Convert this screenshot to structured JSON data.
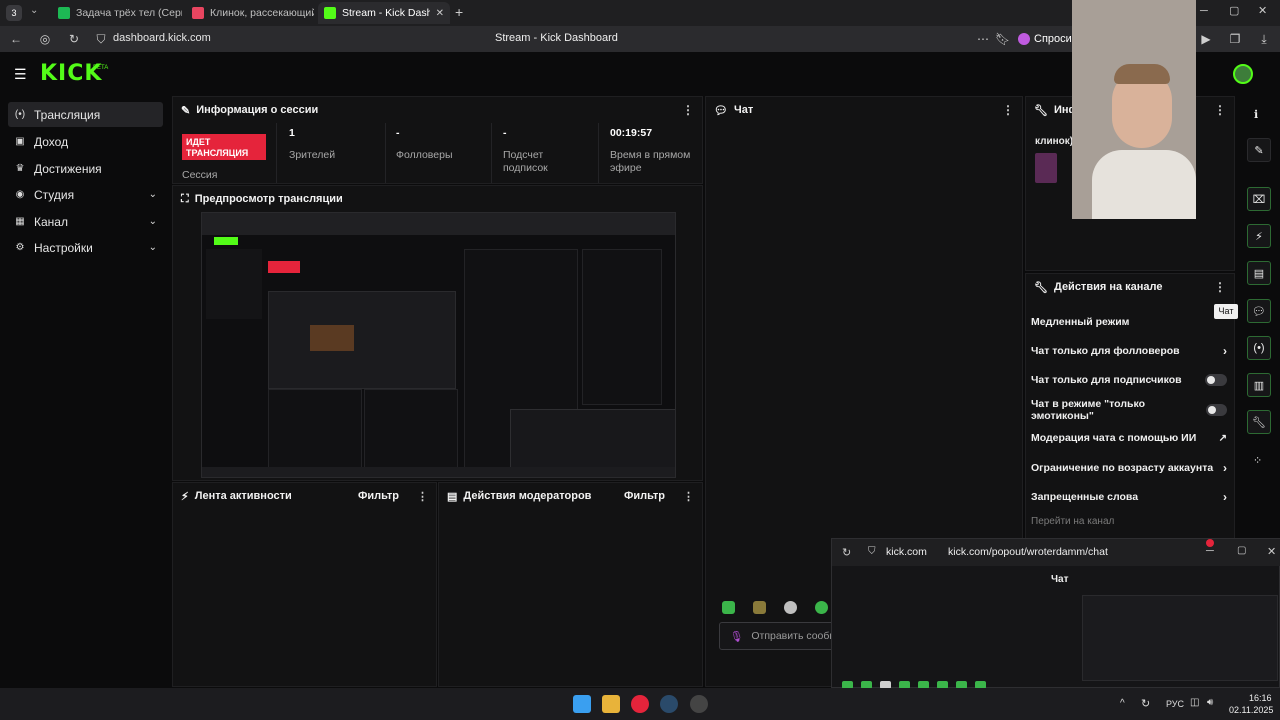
{
  "browser": {
    "tab_count": "3",
    "tabs": [
      {
        "title": "Задача трёх тел (Сериал"
      },
      {
        "title": "Клинок, рассекающий де"
      },
      {
        "title": "Stream - Kick Dashboar"
      }
    ],
    "url": "dashboard.kick.com",
    "page_title": "Stream - Kick Dashboard",
    "ask_label": "Спроси"
  },
  "app": {
    "logo": "KICK",
    "logo_badge": "BETA"
  },
  "sidebar": {
    "items": [
      {
        "label": "Трансляция",
        "icon": "broadcast-icon"
      },
      {
        "label": "Доход",
        "icon": "wallet-icon"
      },
      {
        "label": "Достижения",
        "icon": "trophy-icon"
      },
      {
        "label": "Студия",
        "icon": "studio-icon"
      },
      {
        "label": "Канал",
        "icon": "channel-icon"
      },
      {
        "label": "Настройки",
        "icon": "gear-icon"
      }
    ]
  },
  "session": {
    "title": "Информация о сессии",
    "live_badge_line1": "ИДЕТ",
    "live_badge_line2": "ТРАНСЛЯЦИЯ",
    "session_label": "Сессия",
    "stats": [
      {
        "value": "1",
        "label": "Зрителей"
      },
      {
        "value": "-",
        "label": "Фолловеры"
      },
      {
        "value": "-",
        "label": "Подсчет подписок"
      },
      {
        "value": "00:19:57",
        "label": "Время в прямом эфире"
      }
    ]
  },
  "preview": {
    "title": "Предпросмотр трансляции"
  },
  "activity": {
    "title": "Лента активности",
    "filter": "Фильтр"
  },
  "moderators": {
    "title": "Действия модераторов",
    "filter": "Фильтр"
  },
  "chat": {
    "title": "Чат",
    "send_placeholder": "Отправить сообщ"
  },
  "info_panel": {
    "title": "Инфо",
    "streamer_fragment": "клинок)"
  },
  "channel_actions": {
    "title": "Действия на канале",
    "tooltip": "Чат",
    "items": [
      {
        "label": "Медленный режим",
        "control": "none"
      },
      {
        "label": "Чат только для фолловеров",
        "control": "chevron"
      },
      {
        "label": "Чат только для подписчиков",
        "control": "toggle"
      },
      {
        "label": "Чат в режиме \"только эмотиконы\"",
        "control": "toggle"
      },
      {
        "label": "Модерация чата с помощью ИИ",
        "control": "external"
      },
      {
        "label": "Ограничение по возрасту аккаунта",
        "control": "chevron"
      },
      {
        "label": "Запрещенные слова",
        "control": "chevron"
      }
    ],
    "go_to_channel": "Перейти на канал"
  },
  "popout": {
    "domain": "kick.com",
    "url": "kick.com/popout/wroterdamm/chat",
    "chat_title": "Чат"
  },
  "taskbar": {
    "lang": "РУС",
    "time": "16:16",
    "date": "02.11.2025"
  },
  "colors": {
    "kick_green": "#53fc18",
    "live_red": "#e5243b",
    "bg": "#0b0b0c",
    "panel": "#121213"
  }
}
